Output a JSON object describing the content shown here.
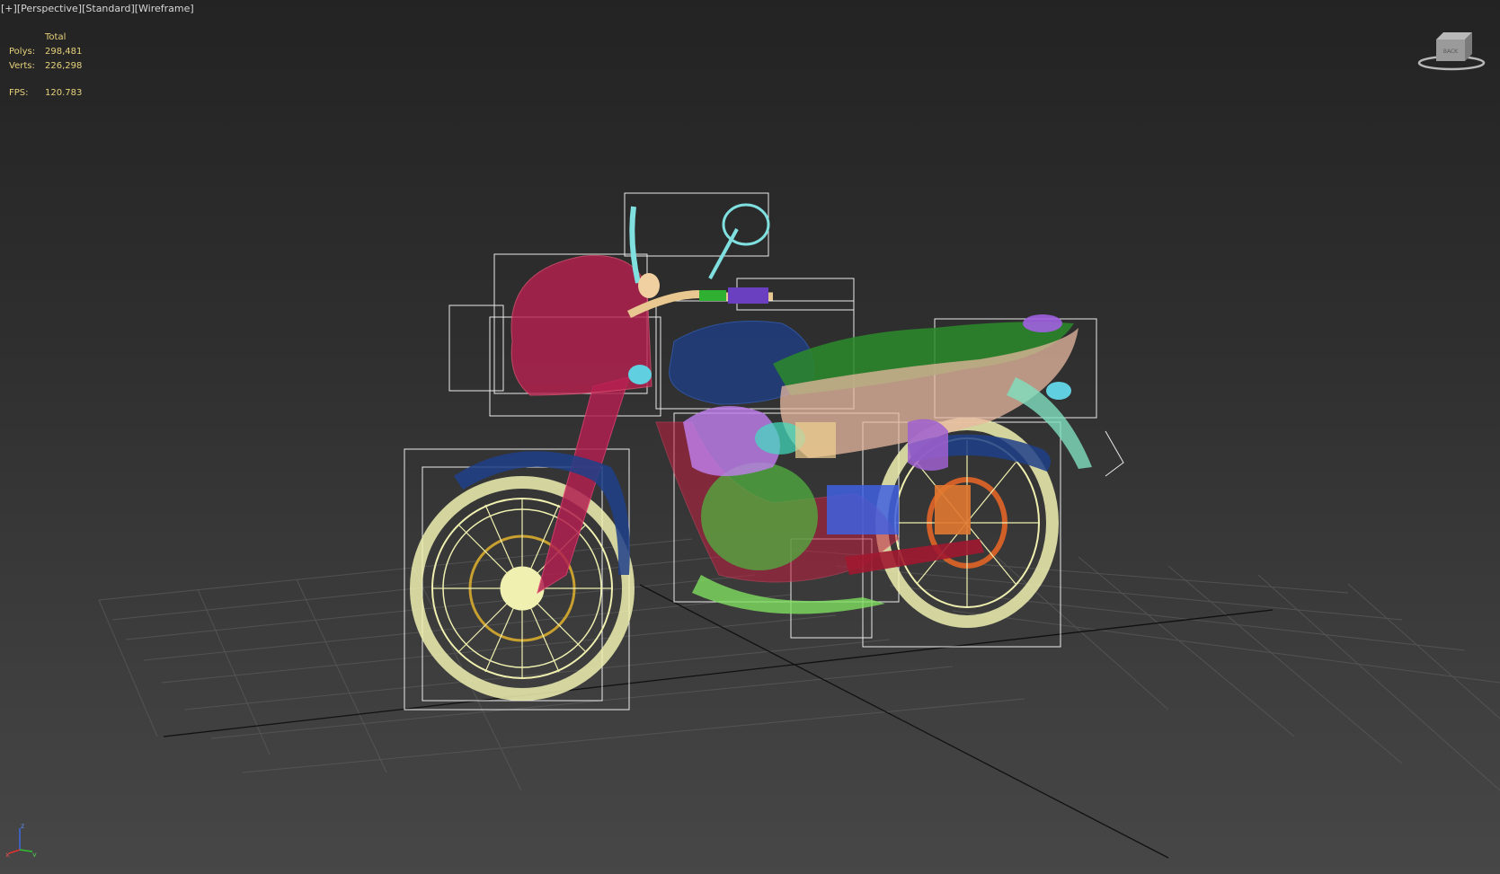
{
  "viewport": {
    "labels": [
      "[+]",
      "[Perspective]",
      "[Standard]",
      "[Wireframe]"
    ]
  },
  "stats": {
    "header": "Total",
    "polys_label": "Polys:",
    "polys_value": "298,481",
    "verts_label": "Verts:",
    "verts_value": "226,298",
    "fps_label": "FPS:",
    "fps_value": "120.783"
  },
  "viewcube": {
    "face_label": "BACK",
    "icon": "viewcube-icon"
  },
  "axis": {
    "x": "x",
    "y": "y",
    "z": "z",
    "icon": "axis-tripod-icon"
  },
  "colors": {
    "stats_text": "#e6d27a",
    "wheel": "#f0f0b0",
    "frame_blue": "#1e3f8a",
    "fuel_tank": "#c0305a",
    "seat_green": "#2a8a2a",
    "seat_pink": "#e8b8a0",
    "cyan_parts": "#80e0e0",
    "purple_parts": "#c080f0",
    "engine_green": "#50b040",
    "orange_parts": "#e07830",
    "bbox_white": "#ffffff",
    "grid_line": "#5a5a5a",
    "world_axis": "#111111"
  }
}
